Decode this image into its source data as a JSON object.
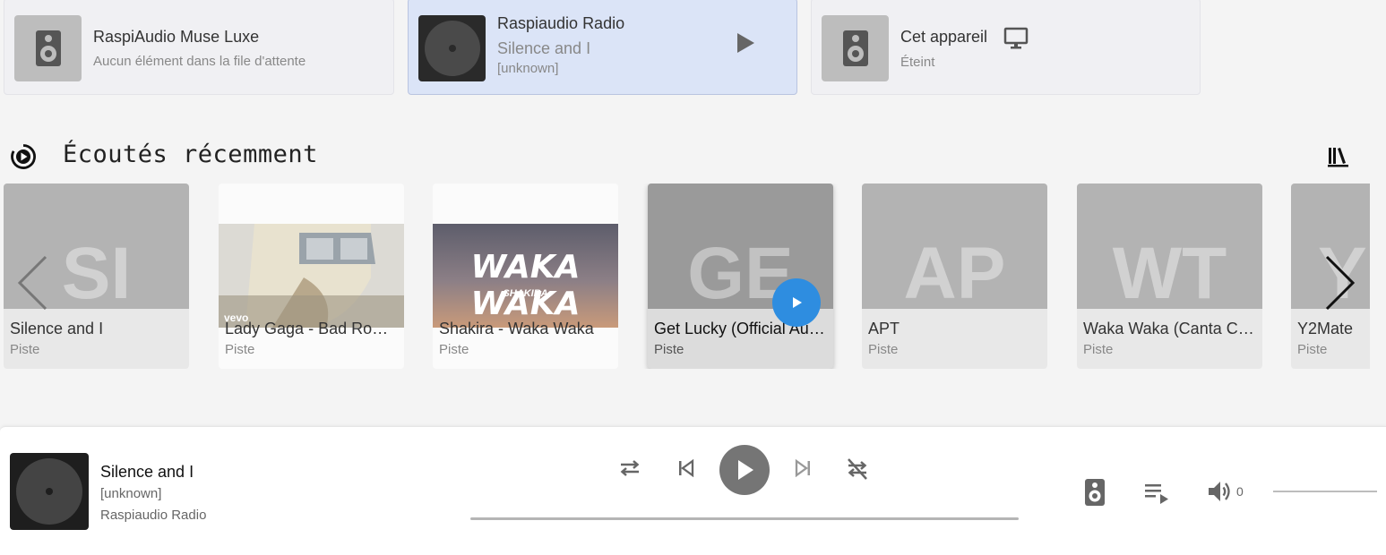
{
  "players": [
    {
      "name": "RaspiAudio Muse Luxe",
      "status": "Aucun élément dans la file d'attente",
      "icon": "speaker-icon"
    },
    {
      "name": "Raspiaudio Radio",
      "track": "Silence and I",
      "artist": "[unknown]",
      "icon": "disc-icon",
      "active": true
    },
    {
      "name": "Cet appareil",
      "status": "Éteint",
      "icon": "speaker-icon"
    }
  ],
  "recent": {
    "title": "Écoutés récemment",
    "items": [
      {
        "initials": "SI",
        "name": "Silence and I",
        "type": "Piste"
      },
      {
        "name": "Lady Gaga - Bad Romance",
        "type": "Piste",
        "art_text": "vevo"
      },
      {
        "name": "Shakira - Waka Waka",
        "type": "Piste",
        "art_text": "WAKA WAKA",
        "art_sub": "SHAKIRA"
      },
      {
        "initials": "GE",
        "name": "Get Lucky (Official Audio)",
        "type": "Piste"
      },
      {
        "initials": "AP",
        "name": "APT",
        "type": "Piste"
      },
      {
        "initials": "WT",
        "name": "Waka Waka (Canta Conmigo)",
        "type": "Piste"
      },
      {
        "initials": "Y",
        "name": "Y2Mate",
        "type": "Piste"
      }
    ]
  },
  "now_playing": {
    "title": "Silence and I",
    "artist": "[unknown]",
    "source": "Raspiaudio Radio",
    "volume": "0"
  },
  "colors": {
    "accent": "#2e8de0",
    "active_card": "#dbe4f7",
    "control": "#757575"
  }
}
